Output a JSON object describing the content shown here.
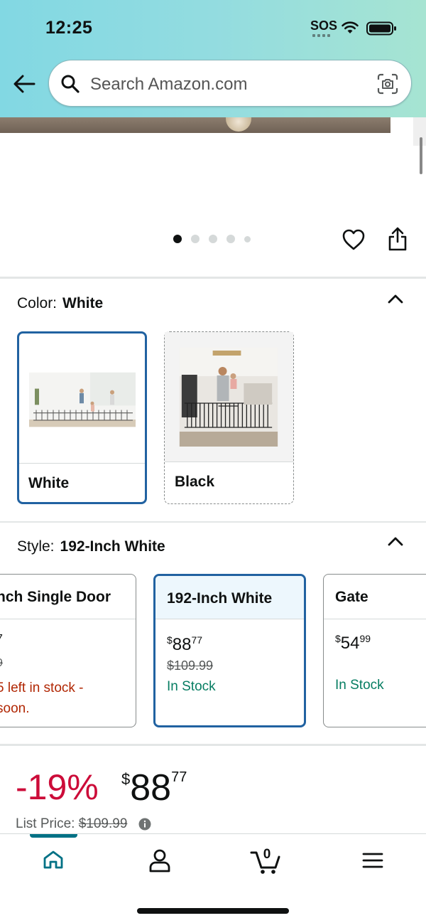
{
  "status_bar": {
    "time": "12:25",
    "sos": "SOS"
  },
  "search": {
    "placeholder": "Search Amazon.com"
  },
  "carousel": {
    "dot_count": 5,
    "active_index": 0
  },
  "color": {
    "label": "Color:",
    "selected": "White",
    "options": [
      {
        "label": "White",
        "selected": true
      },
      {
        "label": "Black",
        "selected": false
      }
    ]
  },
  "style": {
    "label": "Style:",
    "selected": "192-Inch White",
    "options": [
      {
        "name": "nch Single Door",
        "price_sym": "",
        "price_whole": "",
        "price_cents": "",
        "list": "",
        "stock1": "5 left in stock -",
        "stock2": "soon.",
        "partial_price_glyph": "7",
        "partial_list_glyph": "9"
      },
      {
        "name": "192-Inch White",
        "price_sym": "$",
        "price_whole": "88",
        "price_cents": "77",
        "list": "$109.99",
        "stock": "In Stock"
      },
      {
        "name": "Gate",
        "price_sym": "$",
        "price_whole": "54",
        "price_cents": "99",
        "stock": "In Stock"
      }
    ]
  },
  "price": {
    "discount": "-19%",
    "symbol": "$",
    "whole": "88",
    "cents": "77",
    "list_label": "List Price:",
    "list_value": "$109.99"
  },
  "bottom_nav": {
    "items": [
      "home-icon",
      "account-icon",
      "cart-icon",
      "menu-icon"
    ],
    "cart_count": "0",
    "active": "home"
  },
  "colors": {
    "accent_blue": "#2162a1",
    "teal": "#007185",
    "deal_red": "#cc0c39",
    "stock_green": "#067d62",
    "low_stock_red": "#b12704"
  }
}
